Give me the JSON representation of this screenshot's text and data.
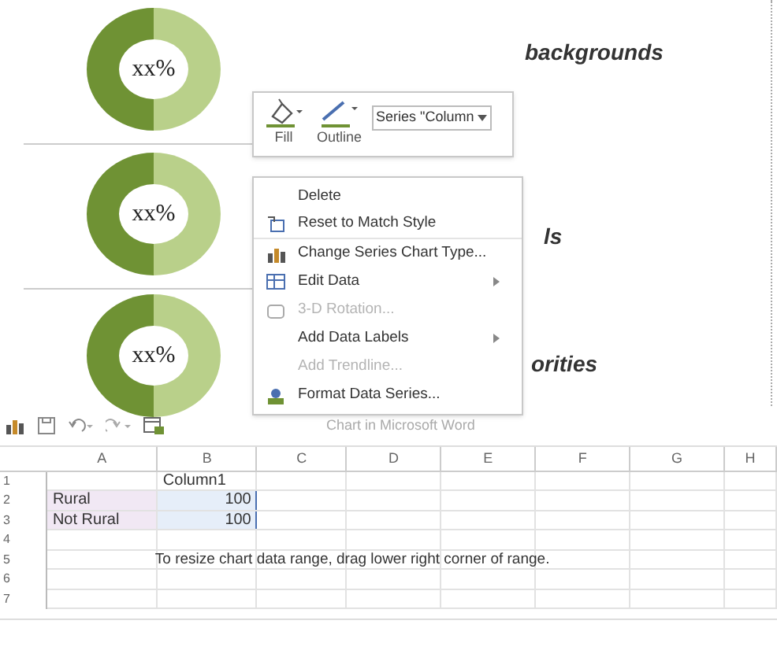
{
  "document": {
    "rows": [
      {
        "label": "xx%",
        "caption": "backgrounds"
      },
      {
        "label": "xx%",
        "caption": "ls"
      },
      {
        "label": "xx%",
        "caption": "orities"
      }
    ]
  },
  "mini_toolbar": {
    "buttons": [
      {
        "label": "Fill"
      },
      {
        "label": "Outline"
      }
    ],
    "series_dropdown": "Series \"Column"
  },
  "context_menu": {
    "items": [
      {
        "label": "Delete",
        "disabled": false,
        "submenu": false
      },
      {
        "label": "Reset to Match Style",
        "disabled": false,
        "submenu": false
      },
      {
        "label": "Change Series Chart Type...",
        "disabled": false,
        "submenu": false
      },
      {
        "label": "Edit Data",
        "disabled": false,
        "submenu": true
      },
      {
        "label": "3-D Rotation...",
        "disabled": true,
        "submenu": false
      },
      {
        "label": "Add Data Labels",
        "disabled": false,
        "submenu": true
      },
      {
        "label": "Add Trendline...",
        "disabled": true,
        "submenu": false
      },
      {
        "label": "Format Data Series...",
        "disabled": false,
        "submenu": false
      }
    ]
  },
  "sheet": {
    "title": "Chart in Microsoft Word",
    "columns": [
      "A",
      "B",
      "C",
      "D",
      "E",
      "F",
      "G",
      "H"
    ],
    "rows": [
      {
        "number": "1",
        "b": "Column1"
      },
      {
        "number": "2",
        "a": "Rural",
        "b": "100"
      },
      {
        "number": "3",
        "a": "Not Rural",
        "b": "100"
      },
      {
        "number": "4"
      },
      {
        "number": "5",
        "note": "To resize chart data range, drag lower right corner of range."
      },
      {
        "number": "6"
      },
      {
        "number": "7"
      }
    ]
  }
}
